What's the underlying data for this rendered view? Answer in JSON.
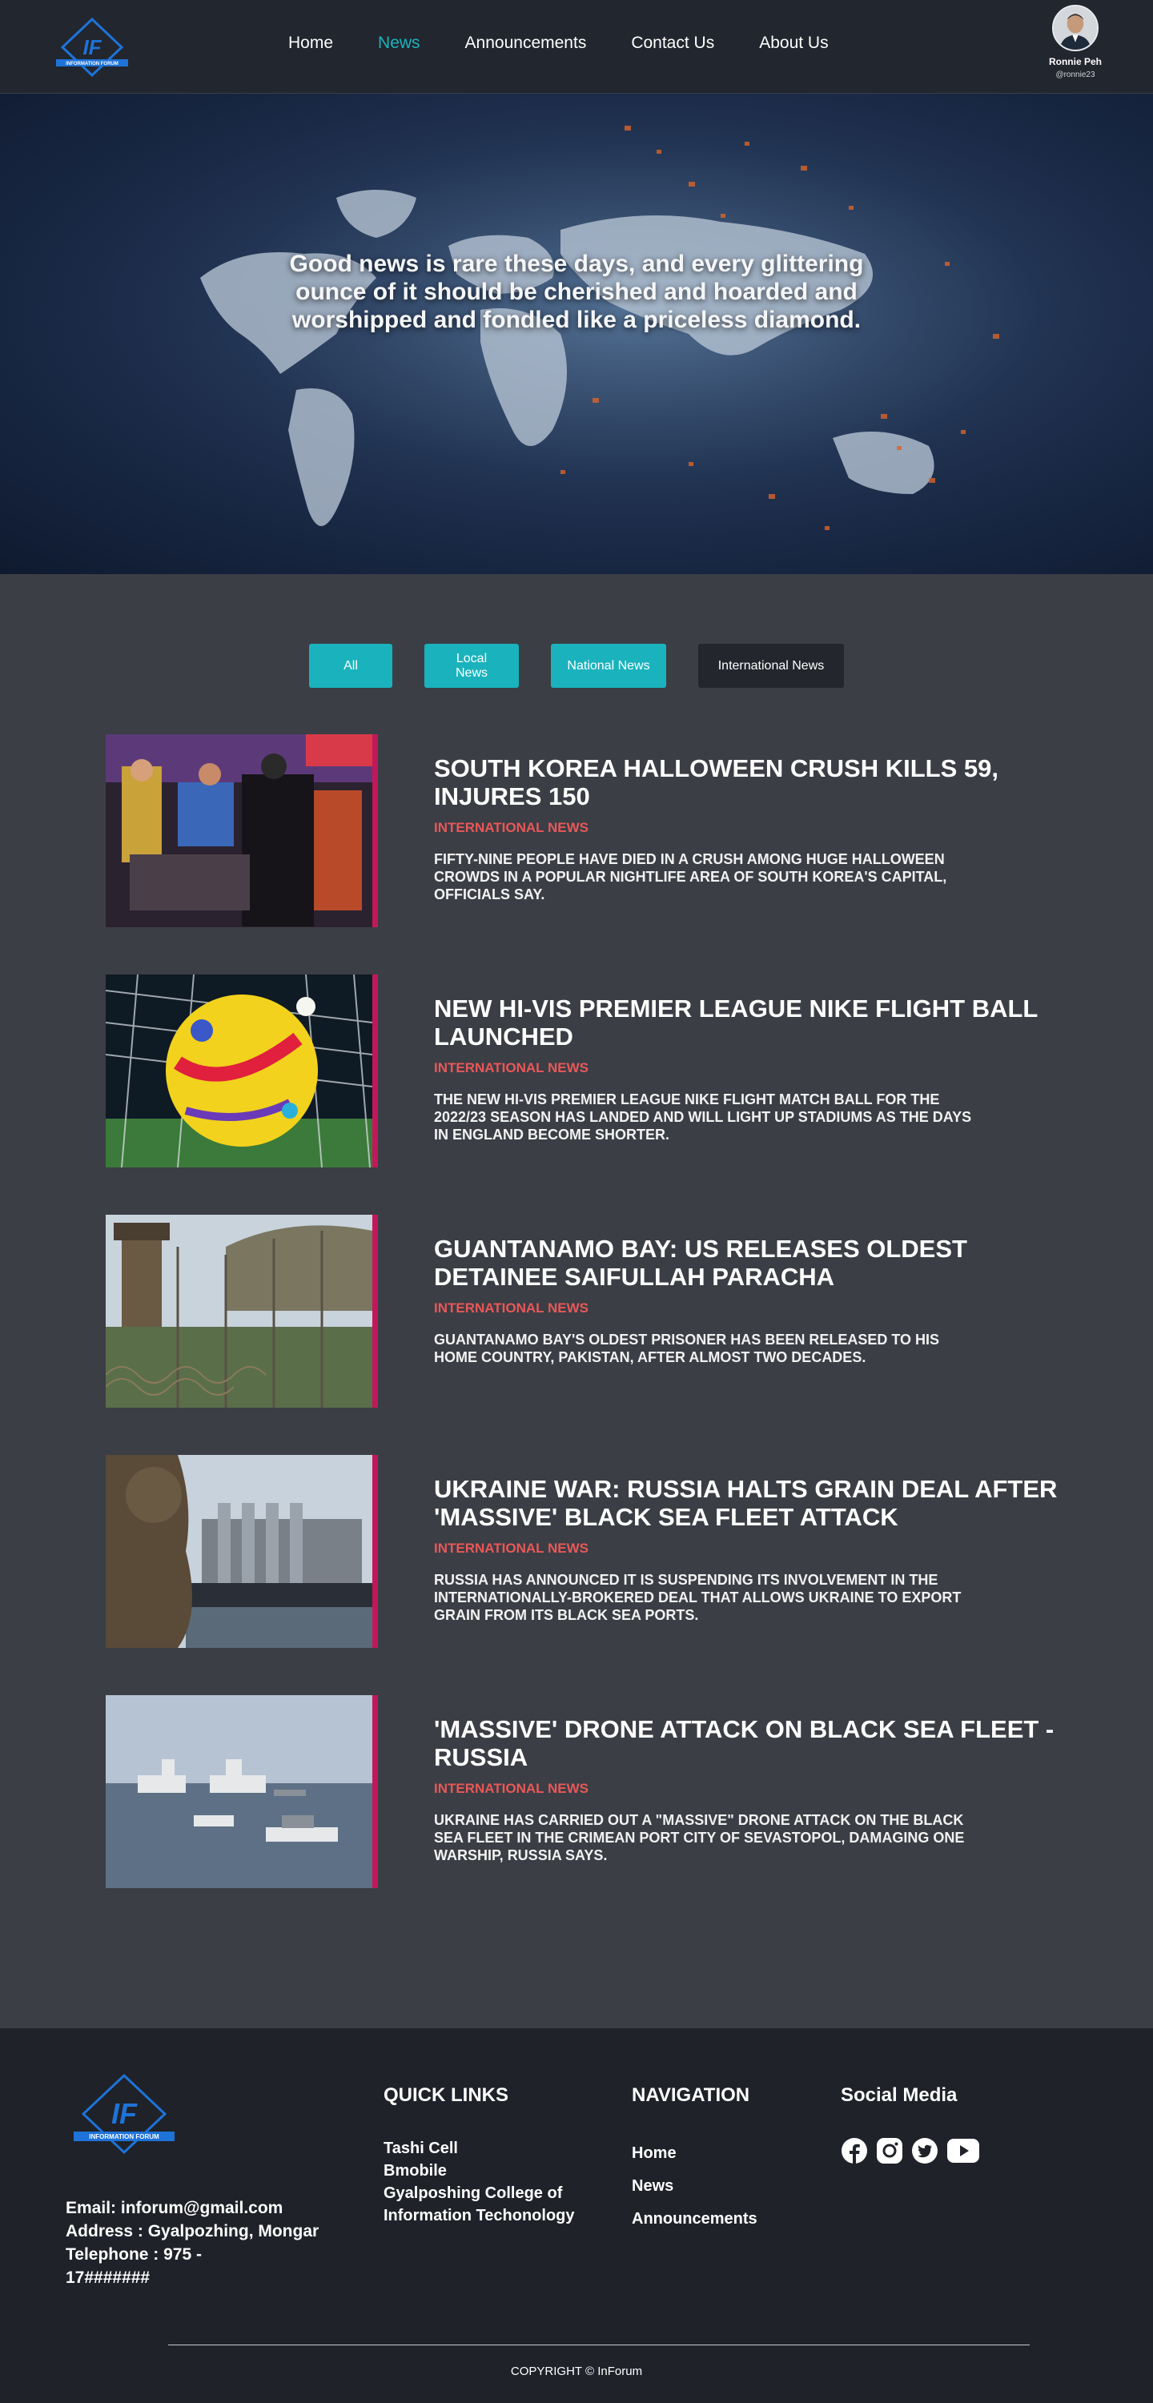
{
  "brand": {
    "logo_text": "IF",
    "logo_subtext": "INFORMATION FORUM"
  },
  "nav": {
    "links": [
      {
        "label": "Home",
        "active": false
      },
      {
        "label": "News",
        "active": true
      },
      {
        "label": "Announcements",
        "active": false
      },
      {
        "label": "Contact Us",
        "active": false
      },
      {
        "label": "About Us",
        "active": false
      }
    ]
  },
  "user": {
    "name": "Ronnie Peh",
    "handle": "@ronnie23"
  },
  "hero": {
    "quote": "Good news is rare these days, and every glittering ounce of it should be cherished and hoarded and worshipped and fondled like a priceless diamond."
  },
  "filters": {
    "all": "All",
    "local": "Local News",
    "national": "National News",
    "international": "International News"
  },
  "articles": [
    {
      "title": "South Korea Halloween crush kills 59, injures 150",
      "category": "International News",
      "description": "Fifty-nine people have died in a crush among huge Halloween crowds in a popular nightlife area of South Korea's capital, officials say.",
      "image": "crowd-rescue-photo"
    },
    {
      "title": "New Hi-Vis Premier League Nike Flight ball launched",
      "category": "International News",
      "description": "The new Hi-Vis Premier League Nike Flight match ball for the 2022/23 season has landed and will light up stadiums as the days in England become shorter.",
      "image": "football-photo"
    },
    {
      "title": "Guantanamo Bay: US releases oldest detainee Saifullah Paracha",
      "category": "International News",
      "description": "Guantanamo Bay's oldest prisoner has been released to his home country, Pakistan, after almost two decades.",
      "image": "prison-fence-photo"
    },
    {
      "title": "Ukraine war: Russia halts grain deal after 'massive' Black Sea Fleet attack",
      "category": "International News",
      "description": "Russia has announced it is suspending its involvement in the internationally-brokered deal that allows Ukraine to export grain from its Black Sea ports.",
      "image": "grain-port-photo"
    },
    {
      "title": "'Massive' drone attack on Black Sea Fleet - Russia",
      "category": "International News",
      "description": "Ukraine has carried out a \"massive\" drone attack on the Black Sea Fleet in the Crimean port city of Sevastopol, damaging one warship, Russia says.",
      "image": "warships-photo"
    }
  ],
  "footer": {
    "contact": {
      "email": "Email:  inforum@gmail.com",
      "address": "Address : Gyalpozhing, Mongar",
      "telephone": "Telephone : 975 -\n17#######"
    },
    "quick_links": {
      "heading": "QUICK LINKS",
      "items": [
        "Tashi Cell",
        "Bmobile",
        "Gyalposhing College of Information Techonology"
      ]
    },
    "navigation": {
      "heading": "NAVIGATION",
      "items": [
        "Home",
        "News",
        "Announcements"
      ]
    },
    "social": {
      "heading": "Social Media",
      "icons": [
        "facebook-icon",
        "instagram-icon",
        "twitter-icon",
        "youtube-icon"
      ]
    },
    "copyright": "COPYRIGHT ©  InForum"
  },
  "colors": {
    "accent": "#1ab3bd",
    "category": "#e85858",
    "thumb_border": "#c2185b",
    "section_bg": "#3b3e45",
    "dark_bg": "#1f2229"
  }
}
